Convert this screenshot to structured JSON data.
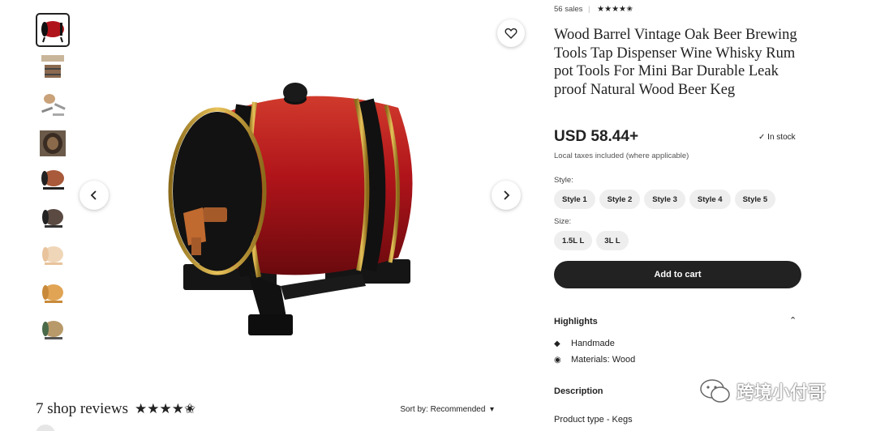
{
  "gallery": {
    "thumbnail_count": 9,
    "active_index": 0
  },
  "listing": {
    "sales": "56 sales",
    "rating_stars": "★★★★✬",
    "title": "Wood Barrel Vintage Oak Beer Brewing Tools Tap Dispenser Wine Whisky Rum pot Tools For Mini Bar Durable Leak proof Natural Wood Beer Keg",
    "price": "USD 58.44+",
    "stock": "In stock",
    "tax_note": "Local taxes included (where applicable)"
  },
  "options": {
    "style_label": "Style:",
    "styles": [
      "Style 1",
      "Style 2",
      "Style 3",
      "Style 4",
      "Style 5"
    ],
    "size_label": "Size:",
    "sizes": [
      "1.5L L",
      "3L L"
    ]
  },
  "cart": {
    "label": "Add to cart"
  },
  "highlights": {
    "title": "Highlights",
    "items": [
      {
        "icon": "tag-icon",
        "label": "Handmade"
      },
      {
        "icon": "materials-icon",
        "label": "Materials: Wood"
      }
    ]
  },
  "description": {
    "title": "Description",
    "first_line": "Product type - Kegs"
  },
  "reviews": {
    "title": "7 shop reviews",
    "stars": "★★★★✬",
    "sort_prefix": "Sort by: ",
    "sort_value": "Recommended"
  },
  "watermark": {
    "text": "跨境小付哥"
  },
  "colors": {
    "barrel_red": "#b0141a",
    "barrel_black": "#111111",
    "brass": "#c8a13a",
    "button_dark": "#222222",
    "chip_bg": "#eeeeee"
  }
}
